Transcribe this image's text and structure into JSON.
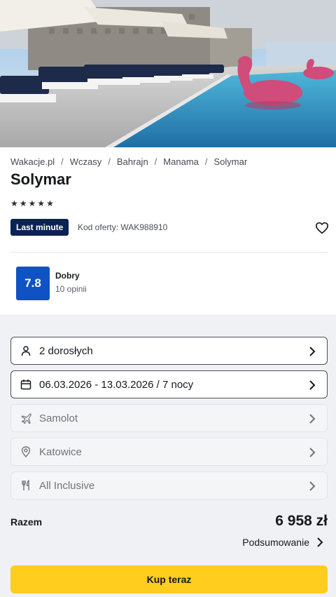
{
  "breadcrumb": [
    "Wakacje.pl",
    "Wczasy",
    "Bahrajn",
    "Manama",
    "Solymar"
  ],
  "hotel": {
    "name": "Solymar",
    "stars": 5,
    "badge": "Last minute",
    "offer_code": "Kod oferty: WAK988910"
  },
  "rating": {
    "score": "7.8",
    "label": "Dobry",
    "count": "10 opinii"
  },
  "fields": {
    "travelers": "2 dorosłych",
    "dates": "06.03.2026 - 13.03.2026 / 7 nocy",
    "transport": "Samolot",
    "departure": "Katowice",
    "board": "All Inclusive"
  },
  "total": {
    "label": "Razem",
    "price": "6 958 zł",
    "summary_label": "Podsumowanie"
  },
  "cta": {
    "buy_label": "Kup teraz"
  },
  "colors": {
    "badge": "#0b2255",
    "score": "#0f52c4",
    "cta": "#ffcd1e"
  }
}
